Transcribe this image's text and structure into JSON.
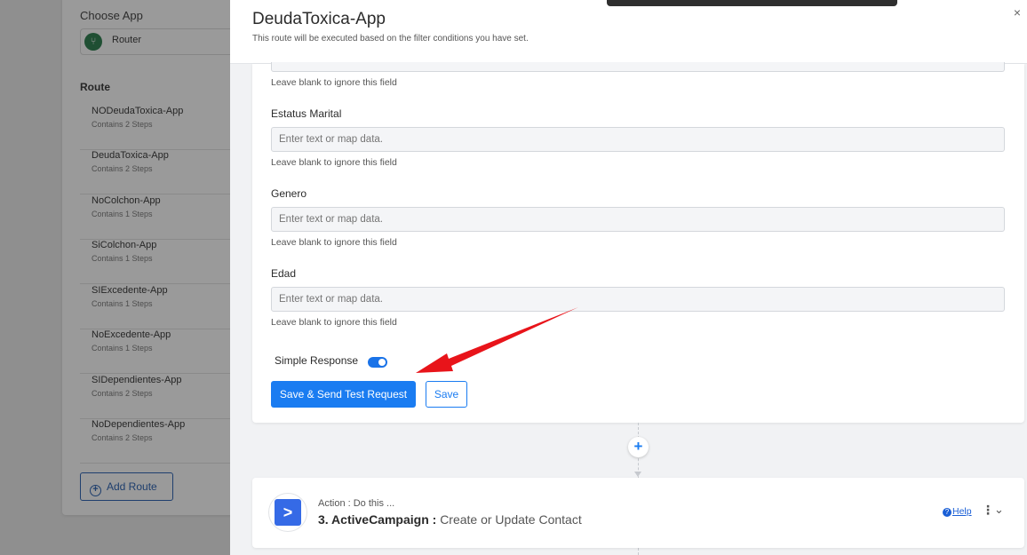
{
  "background": {
    "choose_app_label": "Choose App",
    "router_value": "Router",
    "route_heading": "Route",
    "routes": [
      {
        "name": "NODeudaToxica-App",
        "steps": "Contains 2 Steps"
      },
      {
        "name": "DeudaToxica-App",
        "steps": "Contains 2 Steps"
      },
      {
        "name": "NoColchon-App",
        "steps": "Contains 1 Steps"
      },
      {
        "name": "SiColchon-App",
        "steps": "Contains 1 Steps"
      },
      {
        "name": "SIExcedente-App",
        "steps": "Contains 1 Steps"
      },
      {
        "name": "NoExcedente-App",
        "steps": "Contains 1 Steps"
      },
      {
        "name": "SIDependientes-App",
        "steps": "Contains 2 Steps"
      },
      {
        "name": "NoDependientes-App",
        "steps": "Contains 2 Steps"
      }
    ],
    "add_route_label": "Add Route"
  },
  "modal": {
    "title": "DeudaToxica-App",
    "subtitle": "This route will be executed based on the filter conditions you have set.",
    "close": "×"
  },
  "form": {
    "hint": "Leave blank to ignore this field",
    "placeholder": "Enter text or map data.",
    "fields": [
      {
        "label": "Estatus Marital"
      },
      {
        "label": "Genero"
      },
      {
        "label": "Edad"
      }
    ],
    "simple_response_label": "Simple Response",
    "simple_response_on": true,
    "save_send_label": "Save & Send Test Request",
    "save_label": "Save"
  },
  "action": {
    "sub": "Action : Do this ...",
    "step": "3. ActiveCampaign :",
    "event": "Create or Update Contact",
    "help": "Help",
    "icon_glyph": ">"
  },
  "colors": {
    "accent": "#1a7cf1",
    "annotation_arrow": "#e8141a"
  }
}
